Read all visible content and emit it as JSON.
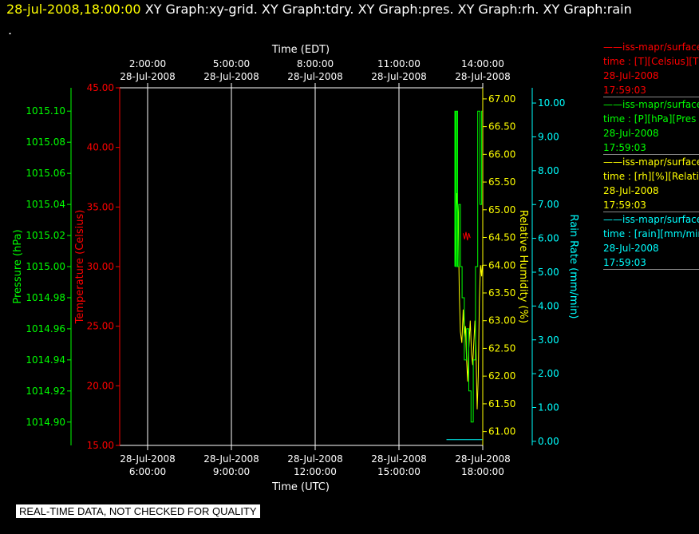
{
  "header": {
    "timestamp": "28-jul-2008,18:00:00",
    "graphs": "XY Graph:xy-grid.  XY Graph:tdry.  XY Graph:pres.  XY Graph:rh.  XY Graph:rain",
    "dot": "."
  },
  "colors": {
    "background": "#000000",
    "temperature": "#ff0000",
    "pressure": "#00ff00",
    "humidity": "#ffff00",
    "rain": "#00ffff",
    "grid": "#ffffff"
  },
  "legend": [
    {
      "source": "iss-mapr/surface",
      "field": "time : [T][Celsius][T",
      "date": "28-Jul-2008",
      "time": "17:59:03",
      "color": "#ff0000"
    },
    {
      "source": "iss-mapr/surface",
      "field": "time : [P][hPa][Pres",
      "date": "28-Jul-2008",
      "time": "17:59:03",
      "color": "#00ff00"
    },
    {
      "source": "iss-mapr/surface",
      "field": "time : [rh][%][Relati",
      "date": "28-Jul-2008",
      "time": "17:59:03",
      "color": "#ffff00"
    },
    {
      "source": "iss-mapr/surface",
      "field": "time : [rain][mm/min",
      "date": "28-Jul-2008",
      "time": "17:59:03",
      "color": "#00ffff"
    }
  ],
  "disclaimer": "REAL-TIME DATA, NOT CHECKED FOR QUALITY",
  "chart_data": {
    "type": "line",
    "top_axis": {
      "title": "Time (EDT)",
      "ticks": [
        {
          "time": "2:00:00",
          "date": "28-Jul-2008"
        },
        {
          "time": "5:00:00",
          "date": "28-Jul-2008"
        },
        {
          "time": "8:00:00",
          "date": "28-Jul-2008"
        },
        {
          "time": "11:00:00",
          "date": "28-Jul-2008"
        },
        {
          "time": "14:00:00",
          "date": "28-Jul-2008"
        }
      ]
    },
    "bottom_axis": {
      "title": "Time (UTC)",
      "range_hours": [
        5.0,
        18.0
      ],
      "ticks": [
        {
          "hour": 6,
          "date": "28-Jul-2008",
          "time": "6:00:00"
        },
        {
          "hour": 9,
          "date": "28-Jul-2008",
          "time": "9:00:00"
        },
        {
          "hour": 12,
          "date": "28-Jul-2008",
          "time": "12:00:00"
        },
        {
          "hour": 15,
          "date": "28-Jul-2008",
          "time": "15:00:00"
        },
        {
          "hour": 18,
          "date": "28-Jul-2008",
          "time": "18:00:00"
        }
      ]
    },
    "grid": true,
    "axes": {
      "pressure": {
        "label": "Pressure (hPa)",
        "ylim": [
          1014.885,
          1015.115
        ],
        "ticks": [
          "1014.90",
          "1014.92",
          "1014.94",
          "1014.96",
          "1014.98",
          "1015.00",
          "1015.02",
          "1015.04",
          "1015.06",
          "1015.08",
          "1015.10"
        ]
      },
      "temperature": {
        "label": "Temperature (Celsius)",
        "ylim": [
          15.0,
          45.0
        ],
        "ticks": [
          "15.00",
          "20.00",
          "25.00",
          "30.00",
          "35.00",
          "40.00",
          "45.00"
        ]
      },
      "humidity": {
        "label": "Relative Humidity (%)",
        "ylim": [
          60.75,
          67.2
        ],
        "ticks": [
          "61.00",
          "61.50",
          "62.00",
          "62.50",
          "63.00",
          "63.50",
          "64.00",
          "64.50",
          "65.00",
          "65.50",
          "66.00",
          "66.50",
          "67.00"
        ]
      },
      "rain": {
        "label": "Rain Rate (mm/min)",
        "ylim": [
          -0.12,
          10.45
        ],
        "ticks": [
          "0.00",
          "1.00",
          "2.00",
          "3.00",
          "4.00",
          "5.00",
          "6.00",
          "7.00",
          "8.00",
          "9.00",
          "10.00"
        ]
      }
    },
    "series": [
      {
        "name": "iss-mapr/surface",
        "axis": "humidity",
        "x": [
          17.0,
          17.04,
          17.08,
          17.12,
          17.16,
          17.2,
          17.25,
          17.3,
          17.34,
          17.38,
          17.42,
          17.46,
          17.5,
          17.55,
          17.6,
          17.64,
          17.68,
          17.72,
          17.76,
          17.8,
          17.84,
          17.88,
          17.92,
          17.96,
          17.98
        ],
        "y": [
          64.0,
          64.7,
          65.3,
          64.9,
          63.5,
          62.8,
          62.6,
          63.2,
          62.7,
          62.9,
          62.3,
          61.9,
          62.5,
          63.0,
          62.4,
          62.2,
          62.6,
          63.0,
          62.4,
          61.4,
          62.0,
          63.4,
          64.0,
          63.8,
          64.0
        ]
      },
      {
        "name": "iss-mapr/surface",
        "axis": "pressure",
        "x": [
          17.0,
          17.0,
          17.03,
          17.03,
          17.06,
          17.06,
          17.1,
          17.1,
          17.14,
          17.14,
          17.2,
          17.2,
          17.26,
          17.26,
          17.34,
          17.34,
          17.42,
          17.42,
          17.5,
          17.5,
          17.58,
          17.58,
          17.66,
          17.66,
          17.74,
          17.74,
          17.82,
          17.82,
          17.9,
          17.9,
          17.96,
          17.96,
          17.98
        ],
        "y": [
          1015.0,
          1015.1,
          1015.1,
          1015.0,
          1015.0,
          1015.1,
          1015.1,
          1015.0,
          1015.0,
          1015.04,
          1015.04,
          1015.0,
          1015.0,
          1014.98,
          1014.98,
          1014.94,
          1014.94,
          1014.96,
          1014.96,
          1014.92,
          1014.92,
          1014.9,
          1014.9,
          1014.94,
          1014.94,
          1015.0,
          1015.0,
          1015.1,
          1015.1,
          1015.04,
          1015.04,
          1015.1,
          1015.1
        ]
      },
      {
        "name": "iss-mapr/surface",
        "axis": "temperature",
        "x": [
          17.3,
          17.35,
          17.4,
          17.45,
          17.5,
          17.55
        ],
        "y": [
          32.8,
          32.3,
          32.9,
          32.2,
          32.8,
          32.4
        ]
      },
      {
        "name": "iss-mapr/surface",
        "axis": "rain",
        "x": [
          16.7,
          17.98
        ],
        "y": [
          0.05,
          0.05
        ]
      }
    ]
  }
}
